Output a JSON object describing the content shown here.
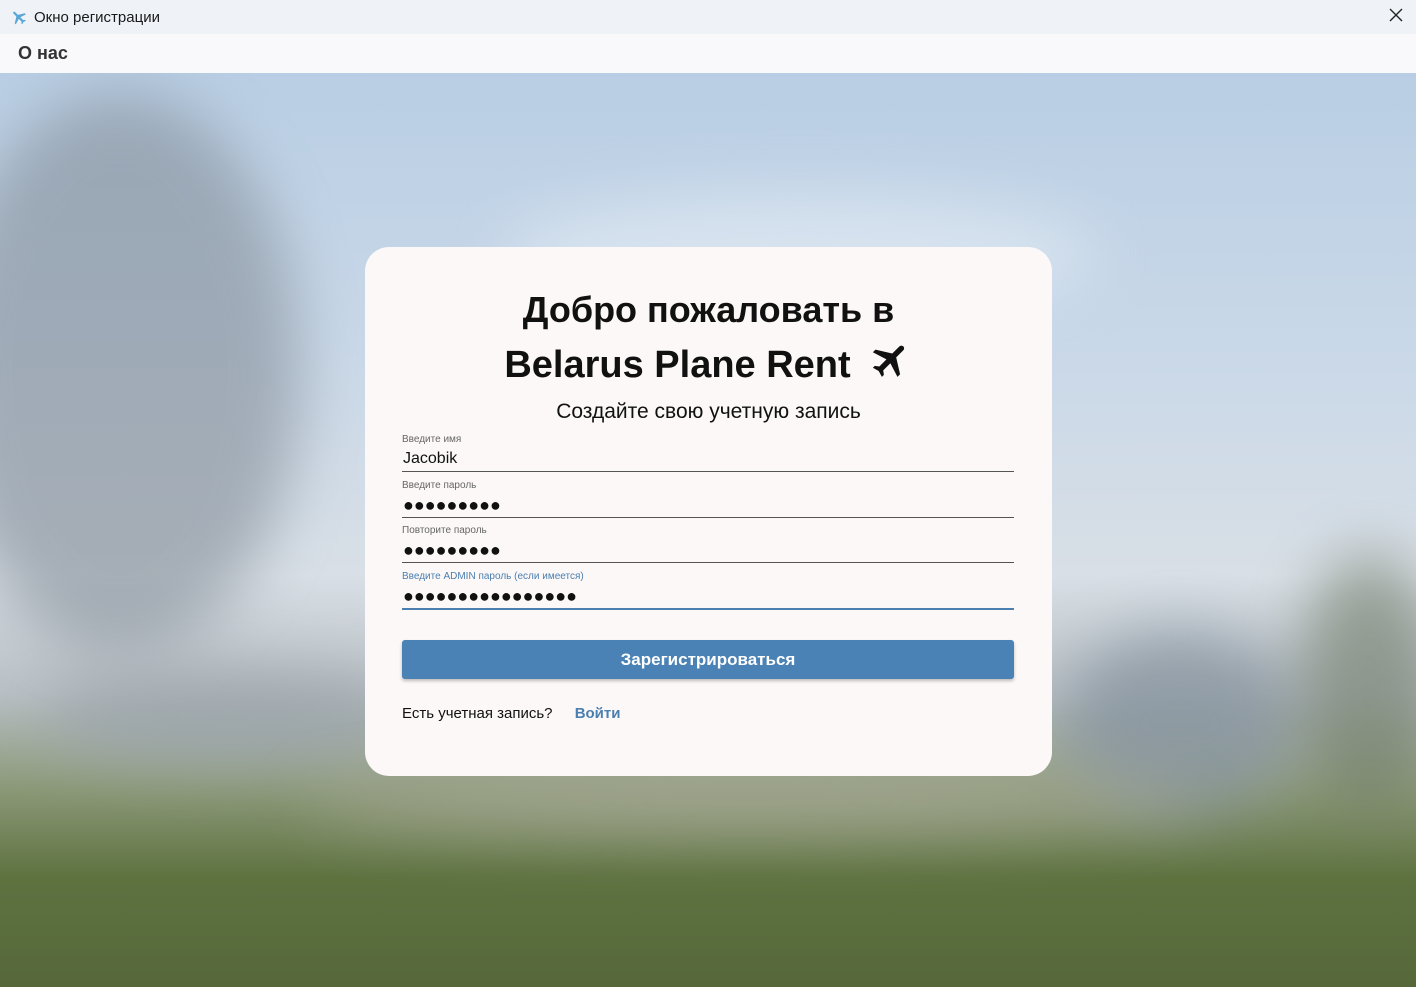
{
  "window": {
    "title": "Окно регистрации",
    "icon": "airplane-icon",
    "close_icon": "close-icon"
  },
  "menu": {
    "about": "О нас"
  },
  "card": {
    "heading_line1": "Добро пожаловать в",
    "heading_line2": "Belarus Plane Rent",
    "heading_icon": "airplane-icon",
    "subheading": "Создайте свою учетную запись",
    "fields": [
      {
        "label": "Введите имя",
        "value": "Jacobik"
      },
      {
        "label": "Введите пароль",
        "value": "●●●●●●●●●"
      },
      {
        "label": "Повторите пароль",
        "value": "●●●●●●●●●"
      },
      {
        "label": "Введите ADMIN пароль (если имеется)",
        "value": "●●●●●●●●●●●●●●●●"
      }
    ],
    "register_button": "Зарегистрироваться",
    "have_account": "Есть учетная запись?",
    "login_link": "Войти"
  },
  "colors": {
    "accent": "#4a82b6",
    "card_bg": "#fcf8f7"
  }
}
